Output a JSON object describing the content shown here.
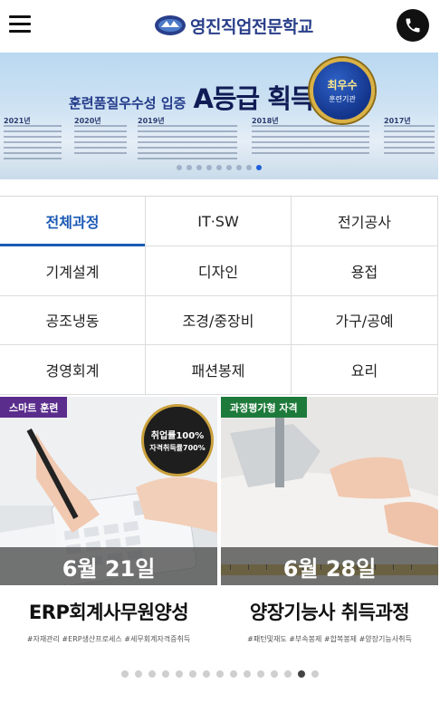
{
  "header": {
    "menu_icon": "hamburger-menu-icon",
    "logo_text": "영진직업전문학교",
    "phone_icon": "phone-icon"
  },
  "banner": {
    "headline_small": "훈련품질우수성 입증",
    "headline_big": "A등급 획득",
    "badge_line1": "최우수",
    "badge_line2": "훈련기관",
    "years": [
      "2021년",
      "2020년",
      "2019년",
      "2018년",
      "2017년"
    ],
    "slide_count": 9,
    "active_slide": 8
  },
  "categories": [
    {
      "label": "전체과정",
      "active": true
    },
    {
      "label": "IT·SW",
      "active": false
    },
    {
      "label": "전기공사",
      "active": false
    },
    {
      "label": "기계설계",
      "active": false
    },
    {
      "label": "디자인",
      "active": false
    },
    {
      "label": "용접",
      "active": false
    },
    {
      "label": "공조냉동",
      "active": false
    },
    {
      "label": "조경/중장비",
      "active": false
    },
    {
      "label": "가구/공예",
      "active": false
    },
    {
      "label": "경영회계",
      "active": false
    },
    {
      "label": "패션봉제",
      "active": false
    },
    {
      "label": "요리",
      "active": false
    }
  ],
  "cards": [
    {
      "tag": "스마트 훈련",
      "tag_color": "#5a2d8c",
      "seal_line1": "취업률100%",
      "seal_line2": "자격취득률700%",
      "date": "6월 21일",
      "title": "ERP회계사무원양성",
      "hashtags": "#자재관리 #ERP생산프로세스 #세무회계자격증취득"
    },
    {
      "tag": "과정평가형 자격",
      "tag_color": "#1e7a3a",
      "date": "6월 28일",
      "title": "양장기능사 취득과정",
      "hashtags": "#패턴및재도 #부속봉제 #합복봉제 #양장기능사취득"
    }
  ],
  "pager": {
    "count": 15,
    "active": 13
  },
  "colors": {
    "accent": "#1a5ab4",
    "logo": "#2a3f8a"
  }
}
